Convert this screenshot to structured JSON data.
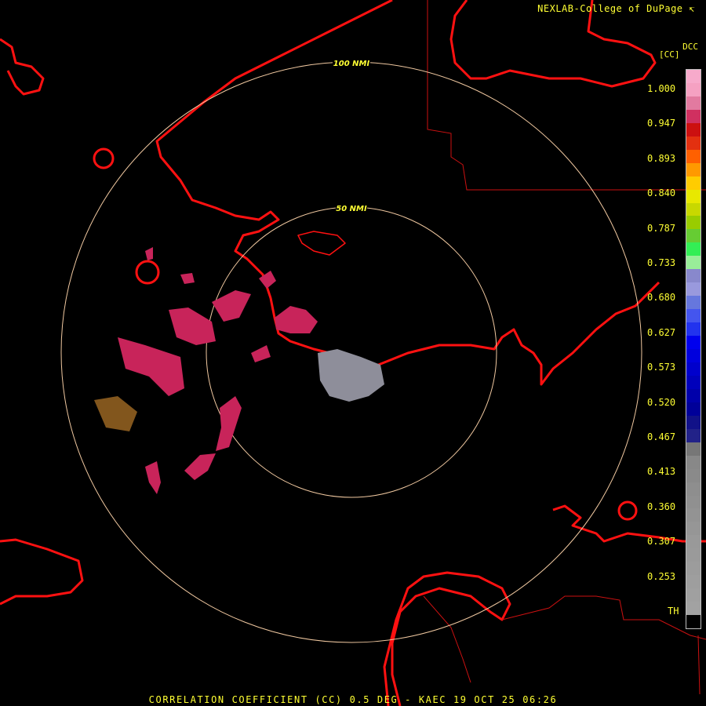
{
  "credit": "NEXLAB-College of DuPage",
  "credit_icon": "arrow-icon",
  "product_code": "DCC",
  "unit_label": "[CC]",
  "footer": "CORRELATION COEFFICIENT (CC) 0.5 DEG - KAEC 19 OCT 25 06:26",
  "range_rings": [
    {
      "label": "100 NMI"
    },
    {
      "label": "50 NMI"
    }
  ],
  "legend": {
    "ticks": [
      "1.000",
      "0.947",
      "0.893",
      "0.840",
      "0.787",
      "0.733",
      "0.680",
      "0.627",
      "0.573",
      "0.520",
      "0.467",
      "0.413",
      "0.360",
      "0.307",
      "0.253",
      "TH"
    ],
    "colors": [
      "#f7aacb",
      "#f5a1c2",
      "#e27aa0",
      "#d03060",
      "#cc1010",
      "#e33010",
      "#ff6000",
      "#ff9900",
      "#ffcc00",
      "#e8e800",
      "#c8d800",
      "#99cc00",
      "#66cc33",
      "#33ee55",
      "#99ee99",
      "#8888cc",
      "#9999dd",
      "#6677dd",
      "#4455ee",
      "#2233ee",
      "#0000ee",
      "#0000dd",
      "#0000cc",
      "#0000bb",
      "#0000aa",
      "#000099",
      "#111188",
      "#222288",
      "#777777",
      "#888888",
      "#8a8a8a",
      "#8e8e8e",
      "#909090",
      "#939393",
      "#969696",
      "#999999",
      "#9a9a9a",
      "#9c9c9c",
      "#9e9e9e",
      "#a0a0a0",
      "#a2a2a2",
      "#000000"
    ]
  },
  "colors": {
    "coast": "#ff1111",
    "boundary": "#cc1111",
    "ring": "#f0c8a0",
    "text": "#ffff33",
    "echo_pink": "#c8245a",
    "echo_grey": "#8e8e9a"
  }
}
